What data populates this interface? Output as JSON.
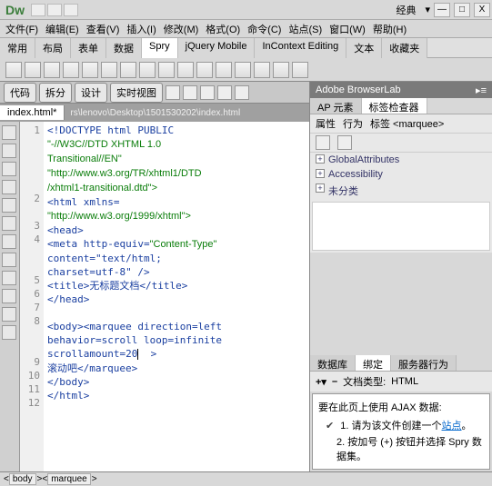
{
  "app": {
    "logo": "Dw",
    "workspace": "经典"
  },
  "window_buttons": {
    "min": "—",
    "max": "□",
    "close": "X"
  },
  "menus": [
    "文件(F)",
    "编辑(E)",
    "查看(V)",
    "插入(I)",
    "修改(M)",
    "格式(O)",
    "命令(C)",
    "站点(S)",
    "窗口(W)",
    "帮助(H)"
  ],
  "insert_tabs": [
    "常用",
    "布局",
    "表单",
    "数据",
    "Spry",
    "jQuery Mobile",
    "InContext Editing",
    "文本",
    "收藏夹"
  ],
  "insert_active": 4,
  "doc_toolbar": {
    "code": "代码",
    "split": "拆分",
    "design": "设计",
    "live": "实时视图"
  },
  "doc_tabs": {
    "active": "index.html*",
    "path": "rs\\lenovo\\Desktop\\1501530202\\index.html"
  },
  "code_lines": [
    {
      "n": "1",
      "t": "<!DOCTYPE html PUBLIC"
    },
    {
      "n": "",
      "t": "\"-//W3C//DTD XHTML 1.0",
      "cls": "str"
    },
    {
      "n": "",
      "t": "Transitional//EN\"",
      "cls": "str"
    },
    {
      "n": "",
      "t": "\"http://www.w3.org/TR/xhtml1/DTD",
      "cls": "str"
    },
    {
      "n": "",
      "t": "/xhtml1-transitional.dtd\">",
      "cls": "str"
    },
    {
      "n": "2",
      "t": "<html xmlns="
    },
    {
      "n": "",
      "t": "\"http://www.w3.org/1999/xhtml\">",
      "cls": "str"
    },
    {
      "n": "3",
      "t": "<head>"
    },
    {
      "n": "4",
      "t": "<meta http-equiv=\"Content-Type\"",
      "mix": true
    },
    {
      "n": "",
      "t": "content=\"text/html;",
      "mix": true
    },
    {
      "n": "",
      "t": "charset=utf-8\" />",
      "mix": true
    },
    {
      "n": "5",
      "t": "<title>无标题文档</title>"
    },
    {
      "n": "6",
      "t": "</head>"
    },
    {
      "n": "7",
      "t": ""
    },
    {
      "n": "8",
      "t": "<body><marquee direction=left"
    },
    {
      "n": "",
      "t": "behavior=scroll loop=infinite"
    },
    {
      "n": "",
      "t": "scrollamount=20|  >",
      "cur": true
    },
    {
      "n": "9",
      "t": "滚动吧</marquee>"
    },
    {
      "n": "10",
      "t": "</body>"
    },
    {
      "n": "11",
      "t": "</html>"
    },
    {
      "n": "12",
      "t": ""
    }
  ],
  "panels": {
    "browserlab": "Adobe BrowserLab",
    "ap": "AP 元素",
    "taginspector": "标签检查器",
    "prop_tabs": {
      "attr": "属性",
      "behav": "行为",
      "tag": "标签 <marquee>"
    },
    "tree": [
      "GlobalAttributes",
      "Accessibility",
      "未分类"
    ],
    "databases": "数据库",
    "bindings": "绑定",
    "server_behav": "服务器行为",
    "doc_type_label": "文档类型:",
    "doc_type_value": "HTML"
  },
  "ajax": {
    "heading": "要在此页上使用 AJAX 数据:",
    "item1_pre": "1. 请为该文件创建一个",
    "item1_link": "站点",
    "item1_post": "。",
    "item2": "2. 按加号 (+) 按钮并选择 Spry 数据集。"
  },
  "status": {
    "body": "body",
    "marquee": "marquee"
  }
}
